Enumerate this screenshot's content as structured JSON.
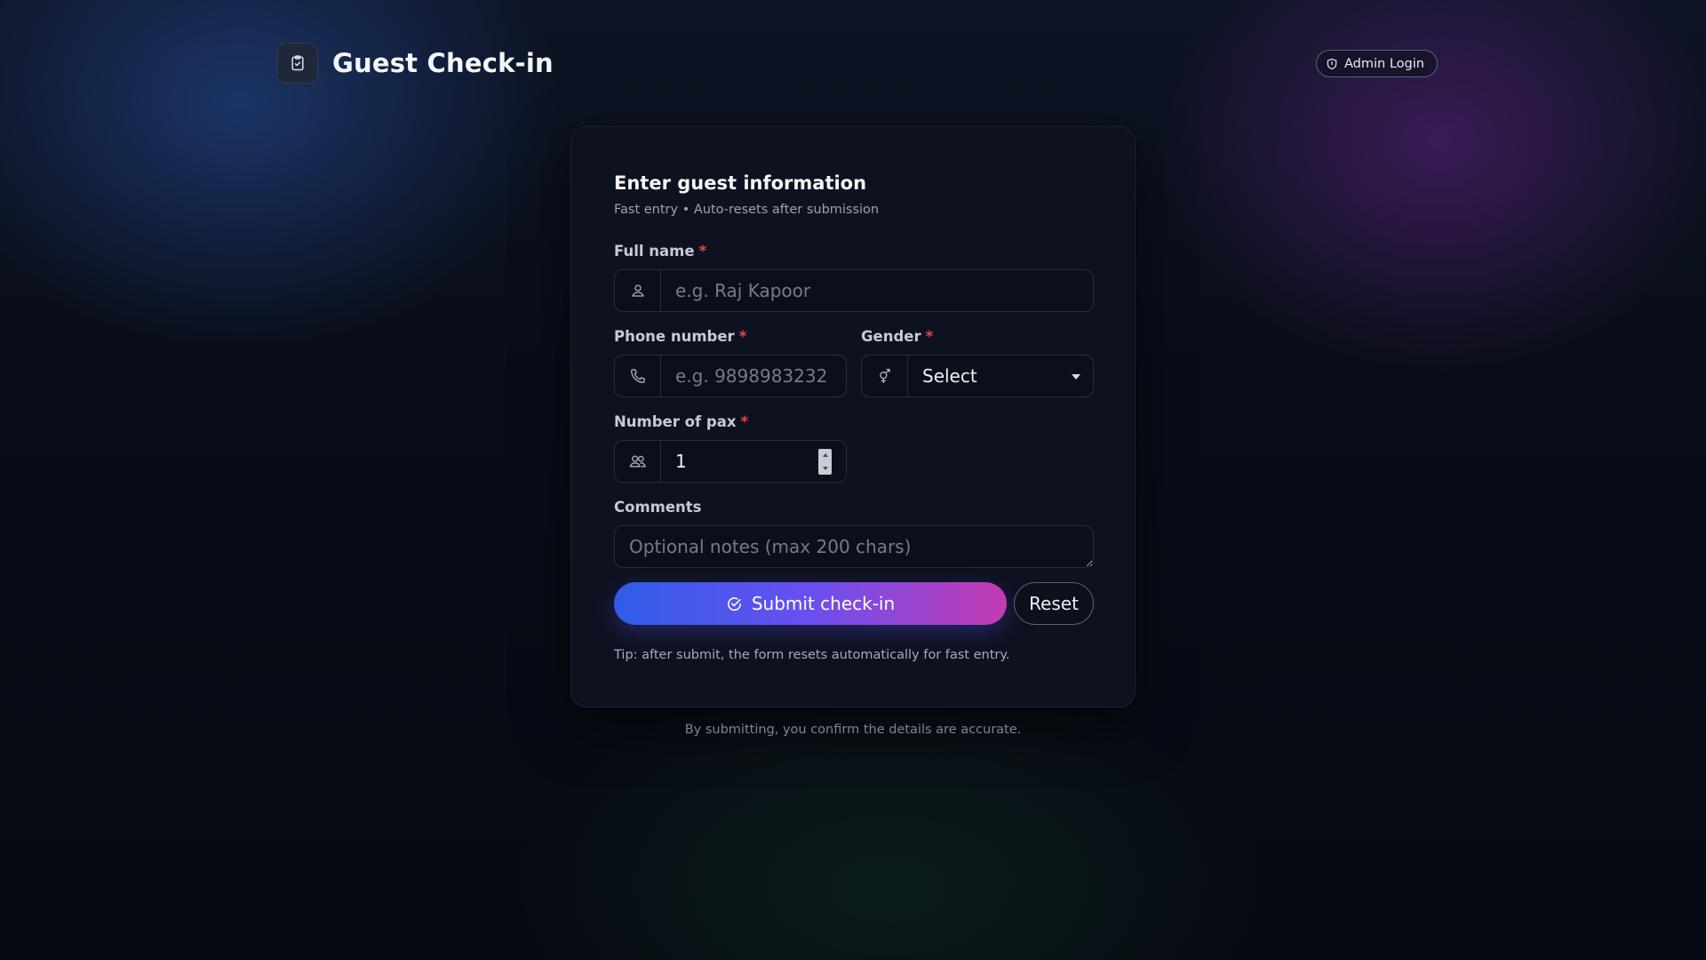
{
  "header": {
    "brand_icon": "clipboard-check-icon",
    "title": "Guest Check-in",
    "admin_login": {
      "label": "Admin Login",
      "icon": "shield-icon"
    }
  },
  "form": {
    "title": "Enter guest information",
    "subtitle": "Fast entry • Auto-resets after submission",
    "required_mark": "*",
    "full_name": {
      "label": "Full name",
      "placeholder": "e.g. Raj Kapoor",
      "value": "",
      "icon": "user-icon"
    },
    "phone": {
      "label": "Phone number",
      "placeholder": "e.g. 9898983232",
      "value": "",
      "icon": "phone-icon"
    },
    "gender": {
      "label": "Gender",
      "selected": "Select",
      "icon": "gender-icon"
    },
    "pax": {
      "label": "Number of pax",
      "value": "1",
      "icon": "users-icon"
    },
    "comments": {
      "label": "Comments",
      "placeholder": "Optional notes (max 200 chars)",
      "value": ""
    },
    "submit": {
      "label": "Submit check-in",
      "icon": "check-circle-icon"
    },
    "reset": {
      "label": "Reset"
    },
    "tip": "Tip: after submit, the form resets automatically for fast entry."
  },
  "footer": {
    "note": "By submitting, you confirm the details are accurate."
  },
  "colors": {
    "background": "#090d18",
    "card": "#0e1220",
    "required": "#e5484d",
    "submit_gradient_start": "#2f5de8",
    "submit_gradient_end": "#c43bb2"
  }
}
